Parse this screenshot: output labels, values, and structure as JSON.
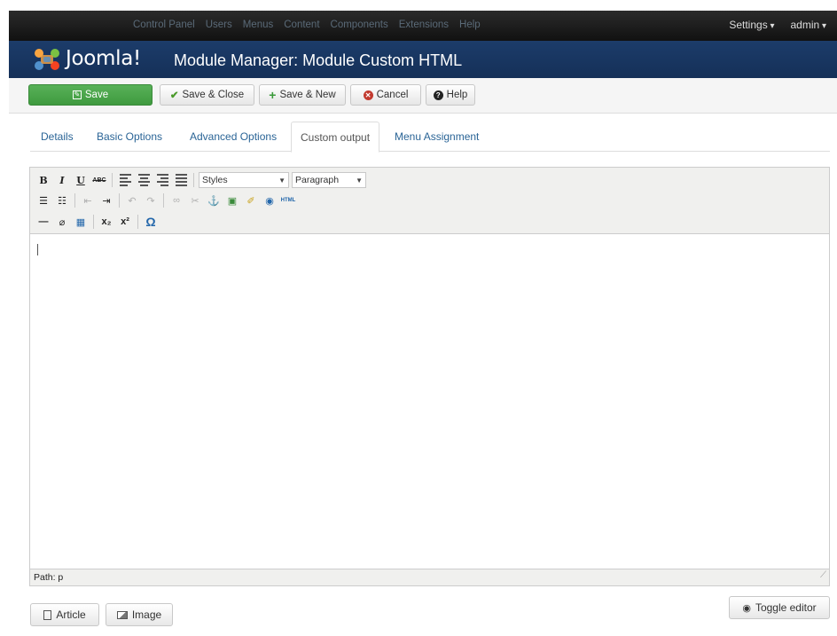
{
  "topnav": {
    "items": [
      "Control Panel",
      "Users",
      "Menus",
      "Content",
      "Components",
      "Extensions",
      "Help"
    ],
    "settings": "Settings",
    "admin": "admin"
  },
  "header": {
    "brand": "Joomla!",
    "title": "Module Manager: Module Custom HTML"
  },
  "toolbar": {
    "save": "Save",
    "save_close": "Save & Close",
    "save_new": "Save & New",
    "cancel": "Cancel",
    "help": "Help"
  },
  "tabs": [
    {
      "label": "Details"
    },
    {
      "label": "Basic Options"
    },
    {
      "label": "Advanced Options"
    },
    {
      "label": "Custom output",
      "active": true
    },
    {
      "label": "Menu Assignment"
    }
  ],
  "editor": {
    "styles_select": "Styles",
    "format_select": "Paragraph",
    "path": "Path: p"
  },
  "buttons": {
    "article": "Article",
    "image": "Image",
    "toggle_editor": "Toggle editor"
  },
  "colors": {
    "topbar": "#1a1a1a",
    "header": "#1c3c6a",
    "save_green": "#46a546",
    "link": "#2a6496"
  }
}
